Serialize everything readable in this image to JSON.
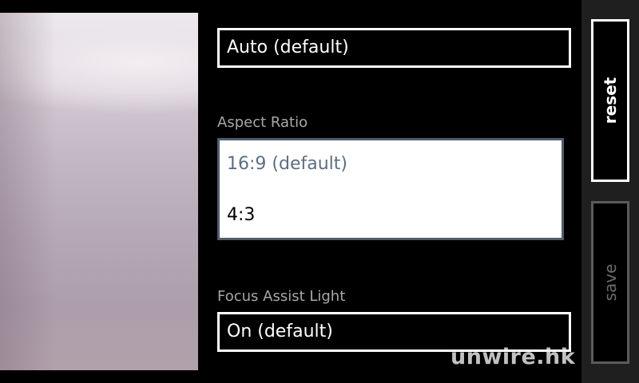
{
  "settings": {
    "top_field_value": "Auto (default)",
    "aspect_ratio": {
      "label": "Aspect Ratio",
      "options": [
        {
          "label": "16:9 (default)",
          "selected": true
        },
        {
          "label": "4:3",
          "selected": false
        }
      ]
    },
    "focus_assist_light": {
      "label": "Focus Assist Light",
      "value": "On (default)"
    }
  },
  "appbar": {
    "reset_label": "reset",
    "save_label": "save"
  },
  "watermark": {
    "text": "unwire.hk"
  },
  "colors": {
    "background": "#000000",
    "appbar_background": "#1f1f1f",
    "label_gray": "#a8a8a8",
    "selected_option": "#5d6e80",
    "disabled": "#5b5b5b"
  }
}
